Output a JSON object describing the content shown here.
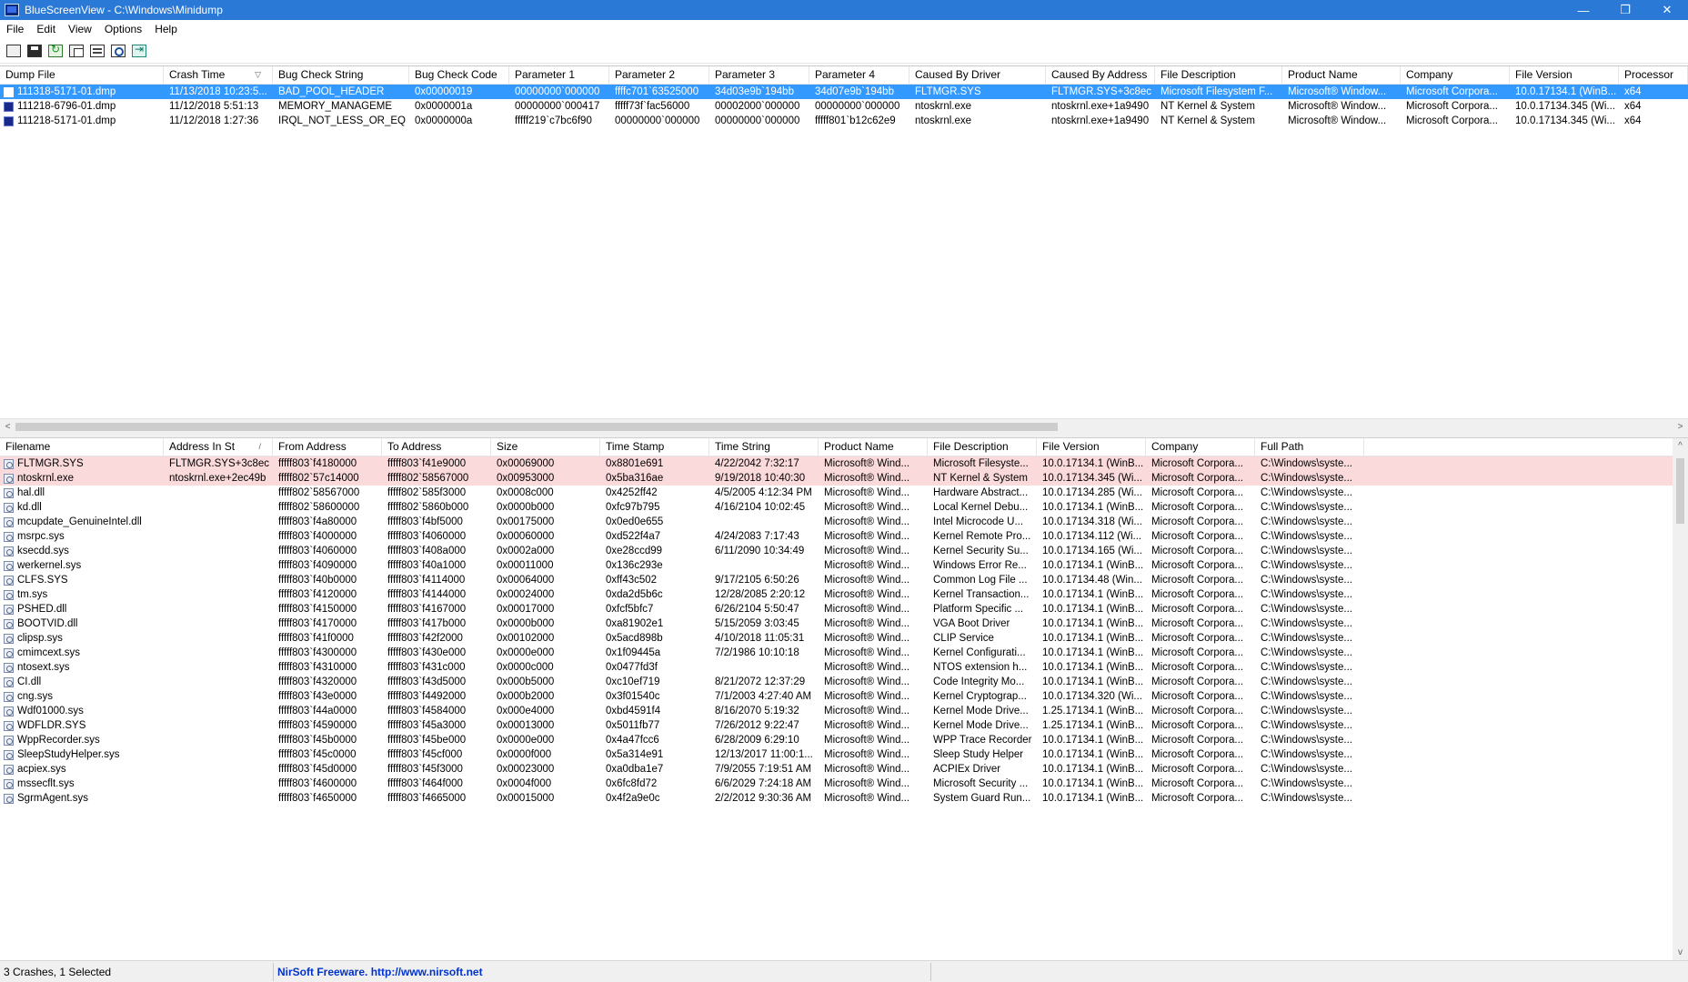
{
  "window": {
    "title": "BlueScreenView  -  C:\\Windows\\Minidump",
    "minimize": "—",
    "maximize": "❐",
    "close": "✕"
  },
  "menu": [
    "File",
    "Edit",
    "View",
    "Options",
    "Help"
  ],
  "toolbar": [
    "html-report-icon",
    "save-icon",
    "refresh-icon",
    "copy-icon",
    "properties-icon",
    "find-icon",
    "exit-icon"
  ],
  "crash_list": {
    "columns": [
      "Dump File",
      "Crash Time",
      "Bug Check String",
      "Bug Check Code",
      "Parameter 1",
      "Parameter 2",
      "Parameter 3",
      "Parameter 4",
      "Caused By Driver",
      "Caused By Address",
      "File Description",
      "Product Name",
      "Company",
      "File Version",
      "Processor"
    ],
    "sort_arrow": "▽",
    "rows": [
      [
        "111318-5171-01.dmp",
        "11/13/2018 10:23:5...",
        "BAD_POOL_HEADER",
        "0x00000019",
        "00000000`000000",
        "ffffc701`63525000",
        "34d03e9b`194bb",
        "34d07e9b`194bb",
        "FLTMGR.SYS",
        "FLTMGR.SYS+3c8ec",
        "Microsoft Filesystem F...",
        "Microsoft® Window...",
        "Microsoft Corpora...",
        "10.0.17134.1 (WinB...",
        "x64"
      ],
      [
        "111218-6796-01.dmp",
        "11/12/2018 5:51:13",
        "MEMORY_MANAGEME",
        "0x0000001a",
        "00000000`000417",
        "fffff73f`fac56000",
        "00002000`000000",
        "00000000`000000",
        "ntoskrnl.exe",
        "ntoskrnl.exe+1a9490",
        "NT Kernel & System",
        "Microsoft® Window...",
        "Microsoft Corpora...",
        "10.0.17134.345 (Wi...",
        "x64"
      ],
      [
        "111218-5171-01.dmp",
        "11/12/2018 1:27:36",
        "IRQL_NOT_LESS_OR_EQ",
        "0x0000000a",
        "fffff219`c7bc6f90",
        "00000000`000000",
        "00000000`000000",
        "fffff801`b12c62e9",
        "ntoskrnl.exe",
        "ntoskrnl.exe+1a9490",
        "NT Kernel & System",
        "Microsoft® Window...",
        "Microsoft Corpora...",
        "10.0.17134.345 (Wi...",
        "x64"
      ]
    ],
    "selected_index": 0,
    "hscroll_left": "<",
    "hscroll_right": ">"
  },
  "driver_list": {
    "columns": [
      "Filename",
      "Address In St",
      "From Address",
      "To Address",
      "Size",
      "Time Stamp",
      "Time String",
      "Product Name",
      "File Description",
      "File Version",
      "Company",
      "Full Path"
    ],
    "sort_arrow": "/",
    "rows": [
      [
        "FLTMGR.SYS",
        "FLTMGR.SYS+3c8ec",
        "fffff803`f4180000",
        "fffff803`f41e9000",
        "0x00069000",
        "0x8801e691",
        "4/22/2042 7:32:17",
        "Microsoft® Wind...",
        "Microsoft Filesyste...",
        "10.0.17134.1 (WinB...",
        "Microsoft Corpora...",
        "C:\\Windows\\syste..."
      ],
      [
        "ntoskrnl.exe",
        "ntoskrnl.exe+2ec49b",
        "fffff802`57c14000",
        "fffff802`58567000",
        "0x00953000",
        "0x5ba316ae",
        "9/19/2018 10:40:30",
        "Microsoft® Wind...",
        "NT Kernel & System",
        "10.0.17134.345 (Wi...",
        "Microsoft Corpora...",
        "C:\\Windows\\syste..."
      ],
      [
        "hal.dll",
        "",
        "fffff802`58567000",
        "fffff802`585f3000",
        "0x0008c000",
        "0x4252ff42",
        "4/5/2005 4:12:34 PM",
        "Microsoft® Wind...",
        "Hardware Abstract...",
        "10.0.17134.285 (Wi...",
        "Microsoft Corpora...",
        "C:\\Windows\\syste..."
      ],
      [
        "kd.dll",
        "",
        "fffff802`58600000",
        "fffff802`5860b000",
        "0x0000b000",
        "0xfc97b795",
        "4/16/2104 10:02:45",
        "Microsoft® Wind...",
        "Local Kernel Debu...",
        "10.0.17134.1 (WinB...",
        "Microsoft Corpora...",
        "C:\\Windows\\syste..."
      ],
      [
        "mcupdate_GenuineIntel.dll",
        "",
        "fffff803`f4a80000",
        "fffff803`f4bf5000",
        "0x00175000",
        "0x0ed0e655",
        "",
        "Microsoft® Wind...",
        "Intel Microcode U...",
        "10.0.17134.318 (Wi...",
        "Microsoft Corpora...",
        "C:\\Windows\\syste..."
      ],
      [
        "msrpc.sys",
        "",
        "fffff803`f4000000",
        "fffff803`f4060000",
        "0x00060000",
        "0xd522f4a7",
        "4/24/2083 7:17:43",
        "Microsoft® Wind...",
        "Kernel Remote Pro...",
        "10.0.17134.112 (Wi...",
        "Microsoft Corpora...",
        "C:\\Windows\\syste..."
      ],
      [
        "ksecdd.sys",
        "",
        "fffff803`f4060000",
        "fffff803`f408a000",
        "0x0002a000",
        "0xe28ccd99",
        "6/11/2090 10:34:49",
        "Microsoft® Wind...",
        "Kernel Security Su...",
        "10.0.17134.165 (Wi...",
        "Microsoft Corpora...",
        "C:\\Windows\\syste..."
      ],
      [
        "werkernel.sys",
        "",
        "fffff803`f4090000",
        "fffff803`f40a1000",
        "0x00011000",
        "0x136c293e",
        "",
        "Microsoft® Wind...",
        "Windows Error Re...",
        "10.0.17134.1 (WinB...",
        "Microsoft Corpora...",
        "C:\\Windows\\syste..."
      ],
      [
        "CLFS.SYS",
        "",
        "fffff803`f40b0000",
        "fffff803`f4114000",
        "0x00064000",
        "0xff43c502",
        "9/17/2105 6:50:26",
        "Microsoft® Wind...",
        "Common Log File ...",
        "10.0.17134.48 (Win...",
        "Microsoft Corpora...",
        "C:\\Windows\\syste..."
      ],
      [
        "tm.sys",
        "",
        "fffff803`f4120000",
        "fffff803`f4144000",
        "0x00024000",
        "0xda2d5b6c",
        "12/28/2085 2:20:12",
        "Microsoft® Wind...",
        "Kernel Transaction...",
        "10.0.17134.1 (WinB...",
        "Microsoft Corpora...",
        "C:\\Windows\\syste..."
      ],
      [
        "PSHED.dll",
        "",
        "fffff803`f4150000",
        "fffff803`f4167000",
        "0x00017000",
        "0xfcf5bfc7",
        "6/26/2104 5:50:47",
        "Microsoft® Wind...",
        "Platform Specific ...",
        "10.0.17134.1 (WinB...",
        "Microsoft Corpora...",
        "C:\\Windows\\syste..."
      ],
      [
        "BOOTVID.dll",
        "",
        "fffff803`f4170000",
        "fffff803`f417b000",
        "0x0000b000",
        "0xa81902e1",
        "5/15/2059 3:03:45",
        "Microsoft® Wind...",
        "VGA Boot Driver",
        "10.0.17134.1 (WinB...",
        "Microsoft Corpora...",
        "C:\\Windows\\syste..."
      ],
      [
        "clipsp.sys",
        "",
        "fffff803`f41f0000",
        "fffff803`f42f2000",
        "0x00102000",
        "0x5acd898b",
        "4/10/2018 11:05:31",
        "Microsoft® Wind...",
        "CLIP Service",
        "10.0.17134.1 (WinB...",
        "Microsoft Corpora...",
        "C:\\Windows\\syste..."
      ],
      [
        "cmimcext.sys",
        "",
        "fffff803`f4300000",
        "fffff803`f430e000",
        "0x0000e000",
        "0x1f09445a",
        "7/2/1986 10:10:18",
        "Microsoft® Wind...",
        "Kernel Configurati...",
        "10.0.17134.1 (WinB...",
        "Microsoft Corpora...",
        "C:\\Windows\\syste..."
      ],
      [
        "ntosext.sys",
        "",
        "fffff803`f4310000",
        "fffff803`f431c000",
        "0x0000c000",
        "0x0477fd3f",
        "",
        "Microsoft® Wind...",
        "NTOS extension h...",
        "10.0.17134.1 (WinB...",
        "Microsoft Corpora...",
        "C:\\Windows\\syste..."
      ],
      [
        "CI.dll",
        "",
        "fffff803`f4320000",
        "fffff803`f43d5000",
        "0x000b5000",
        "0xc10ef719",
        "8/21/2072 12:37:29",
        "Microsoft® Wind...",
        "Code Integrity Mo...",
        "10.0.17134.1 (WinB...",
        "Microsoft Corpora...",
        "C:\\Windows\\syste..."
      ],
      [
        "cng.sys",
        "",
        "fffff803`f43e0000",
        "fffff803`f4492000",
        "0x000b2000",
        "0x3f01540c",
        "7/1/2003 4:27:40 AM",
        "Microsoft® Wind...",
        "Kernel Cryptograp...",
        "10.0.17134.320 (Wi...",
        "Microsoft Corpora...",
        "C:\\Windows\\syste..."
      ],
      [
        "Wdf01000.sys",
        "",
        "fffff803`f44a0000",
        "fffff803`f4584000",
        "0x000e4000",
        "0xbd4591f4",
        "8/16/2070 5:19:32",
        "Microsoft® Wind...",
        "Kernel Mode Drive...",
        "1.25.17134.1 (WinB...",
        "Microsoft Corpora...",
        "C:\\Windows\\syste..."
      ],
      [
        "WDFLDR.SYS",
        "",
        "fffff803`f4590000",
        "fffff803`f45a3000",
        "0x00013000",
        "0x5011fb77",
        "7/26/2012 9:22:47",
        "Microsoft® Wind...",
        "Kernel Mode Drive...",
        "1.25.17134.1 (WinB...",
        "Microsoft Corpora...",
        "C:\\Windows\\syste..."
      ],
      [
        "WppRecorder.sys",
        "",
        "fffff803`f45b0000",
        "fffff803`f45be000",
        "0x0000e000",
        "0x4a47fcc6",
        "6/28/2009 6:29:10",
        "Microsoft® Wind...",
        "WPP Trace Recorder",
        "10.0.17134.1 (WinB...",
        "Microsoft Corpora...",
        "C:\\Windows\\syste..."
      ],
      [
        "SleepStudyHelper.sys",
        "",
        "fffff803`f45c0000",
        "fffff803`f45cf000",
        "0x0000f000",
        "0x5a314e91",
        "12/13/2017 11:00:1...",
        "Microsoft® Wind...",
        "Sleep Study Helper",
        "10.0.17134.1 (WinB...",
        "Microsoft Corpora...",
        "C:\\Windows\\syste..."
      ],
      [
        "acpiex.sys",
        "",
        "fffff803`f45d0000",
        "fffff803`f45f3000",
        "0x00023000",
        "0xa0dba1e7",
        "7/9/2055 7:19:51 AM",
        "Microsoft® Wind...",
        "ACPIEx Driver",
        "10.0.17134.1 (WinB...",
        "Microsoft Corpora...",
        "C:\\Windows\\syste..."
      ],
      [
        "mssecflt.sys",
        "",
        "fffff803`f4600000",
        "fffff803`f464f000",
        "0x0004f000",
        "0x6fc8fd72",
        "6/6/2029 7:24:18 AM",
        "Microsoft® Wind...",
        "Microsoft Security ...",
        "10.0.17134.1 (WinB...",
        "Microsoft Corpora...",
        "C:\\Windows\\syste..."
      ],
      [
        "SgrmAgent.sys",
        "",
        "fffff803`f4650000",
        "fffff803`f4665000",
        "0x00015000",
        "0x4f2a9e0c",
        "2/2/2012 9:30:36 AM",
        "Microsoft® Wind...",
        "System Guard Run...",
        "10.0.17134.1 (WinB...",
        "Microsoft Corpora...",
        "C:\\Windows\\syste..."
      ]
    ],
    "highlighted_count": 2,
    "vscroll_up": "^",
    "vscroll_down": "v"
  },
  "status": {
    "summary": "3 Crashes, 1 Selected",
    "credit": "NirSoft Freeware.  http://www.nirsoft.net"
  }
}
